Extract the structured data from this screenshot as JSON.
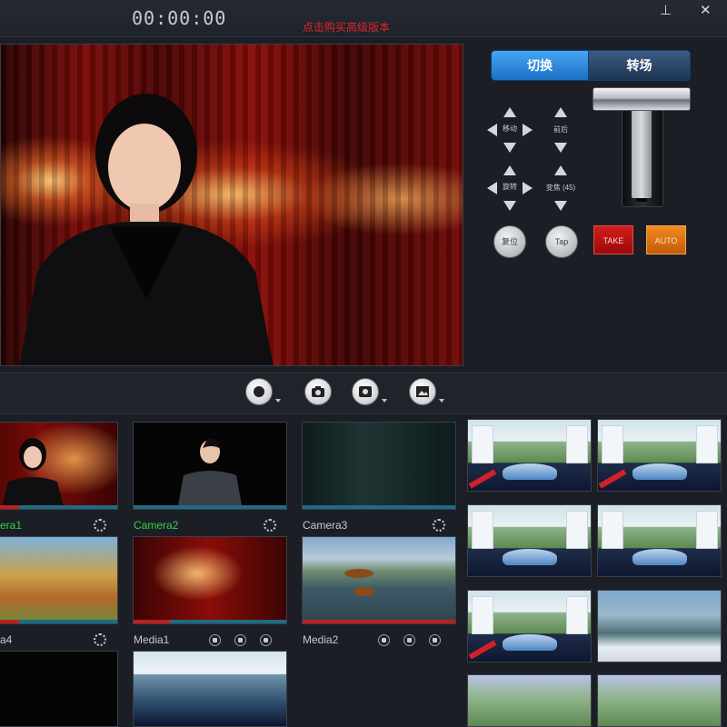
{
  "header": {
    "timecode": "00:00:00",
    "banner": "点击购买高级版本",
    "pin_icon": "⊥",
    "close_icon": "✕"
  },
  "control": {
    "tabs": [
      "切换",
      "转场"
    ],
    "move_label": "移动",
    "front_back_label": "前后",
    "rotate_label": "旋转",
    "zoom_label": "变焦 (45)",
    "reset_label": "复位",
    "tap_label": "Tap",
    "take_label": "TAKE",
    "auto_label": "AUTO"
  },
  "sources": [
    {
      "label": "era1",
      "color": "#34d04b"
    },
    {
      "label": "Camera2",
      "color": "#34d04b"
    },
    {
      "label": "Camera3",
      "color": "#c5cbd3"
    },
    {
      "label": "a4",
      "color": "#c5cbd3"
    },
    {
      "label": "Media1",
      "color": "#c5cbd3"
    },
    {
      "label": "Media2",
      "color": "#c5cbd3"
    }
  ],
  "icons": [
    "record-icon",
    "camera-icon",
    "snapshot-icon",
    "image-icon",
    "gear-icon"
  ]
}
